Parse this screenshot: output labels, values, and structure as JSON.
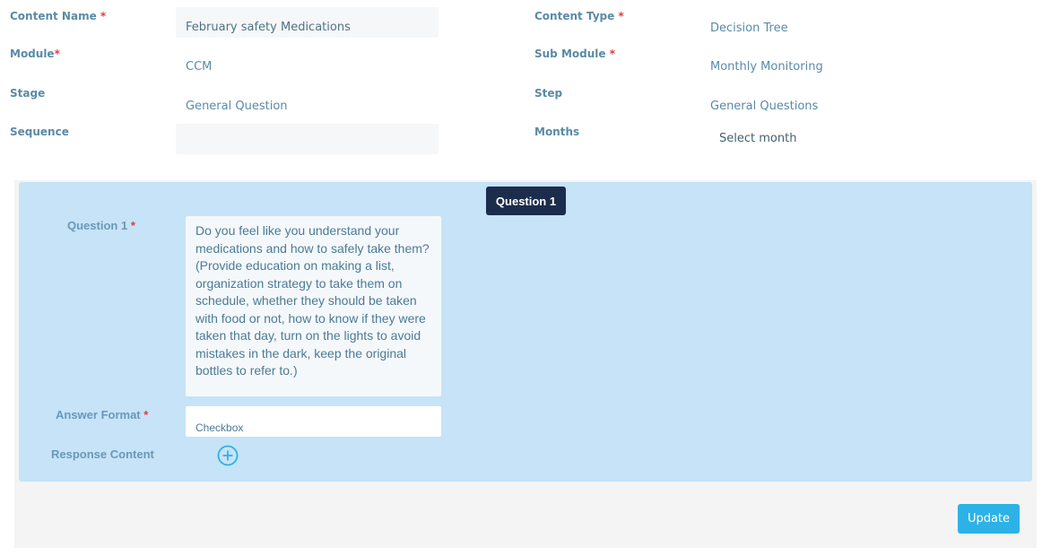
{
  "form": {
    "content_name": {
      "label": "Content Name",
      "value": "February safety Medications"
    },
    "content_type": {
      "label": "Content Type",
      "value": "Decision Tree"
    },
    "module": {
      "label": "Module",
      "value": "CCM"
    },
    "sub_module": {
      "label": "Sub Module",
      "value": "Monthly Monitoring"
    },
    "stage": {
      "label": "Stage",
      "value": "General Question"
    },
    "step": {
      "label": "Step",
      "value": "General Questions"
    },
    "sequence": {
      "label": "Sequence",
      "value": ""
    },
    "months": {
      "label": "Months",
      "value": "Select month"
    },
    "required_marker": "*"
  },
  "question_panel": {
    "badge": "Question 1",
    "question_label": "Question 1",
    "question_text": "Do you feel like you understand your medications and how to safely take them? (Provide education on making a list, organization strategy to take them on schedule, whether they should be taken with food or not, how to know if they were taken that day, turn on the lights to avoid mistakes in the dark, keep the original bottles to refer to.)",
    "answer_format_label": "Answer Format",
    "answer_format_value": "Checkbox",
    "response_content_label": "Response Content",
    "add_icon": "plus-circle-icon"
  },
  "actions": {
    "update_label": "Update"
  },
  "colors": {
    "panel_bg": "#c6e3f8",
    "badge_bg": "#1c2c4d",
    "update_bg": "#2cb2e6",
    "required": "#e23b3b"
  }
}
